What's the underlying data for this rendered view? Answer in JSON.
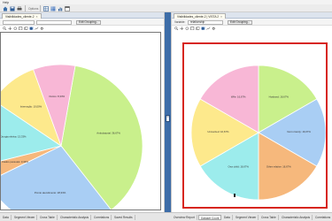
{
  "menubar": {
    "items": [
      "Help"
    ]
  },
  "toolbar": {
    "label": "Options"
  },
  "left_panel": {
    "tab_label": "Visibilidades_cliente-2",
    "tab_close": "×",
    "edit_grouping": "Edit Grouping...",
    "slices": [
      {
        "label": "Ambulatorial: 36,67%",
        "percent": 36.67,
        "color": "#c9f08c"
      },
      {
        "label": "Pronto atendimento: 28,33%",
        "percent": 28.33,
        "color": "#a9cef4"
      },
      {
        "label": "Dados pessoais: 3,33%",
        "percent": 3.33,
        "color": "#f6b87c"
      },
      {
        "label": "Cirurgia eletiva: 13,33%",
        "percent": 13.33,
        "color": "#9cecec"
      },
      {
        "label": "Internação: 10,00%",
        "percent": 10.0,
        "color": "#fde98c"
      },
      {
        "label": "Outros: 8,33%",
        "percent": 8.33,
        "color": "#f8b7d6"
      }
    ]
  },
  "right_panel": {
    "tab_label": "Visibilidades_cliente-2 | VISTA 2",
    "tab_close": "×",
    "variable_label": "Variable:",
    "variable_value": "relationship",
    "edit_grouping": "Edit Grouping...",
    "slices": [
      {
        "label": "Husband: 16,67%",
        "percent": 16.67,
        "color": "#c9f08c"
      },
      {
        "label": "Not in family: 16,67%",
        "percent": 16.67,
        "color": "#a9cef4"
      },
      {
        "label": "Other relative: 16,67%",
        "percent": 16.67,
        "color": "#f6b87c"
      },
      {
        "label": "Own child: 16,67%",
        "percent": 16.67,
        "color": "#9cecec"
      },
      {
        "label": "Unmarried: 16,67%",
        "percent": 16.67,
        "color": "#fde98c"
      },
      {
        "label": "Wife: 16,67%",
        "percent": 16.67,
        "color": "#f8b7d6"
      }
    ]
  },
  "bottom_tabs_left": [
    "Data",
    "Segment Viewer",
    "Cross Table",
    "Characteristic Analysis",
    "Correlations",
    "Saved Results"
  ],
  "bottom_tabs_right": [
    "Overview Report",
    "Dataset Count",
    "Data",
    "Segment Viewer",
    "Cross Table",
    "Characteristic Analysis",
    "Correlations",
    "Saved Results"
  ],
  "bottom_active_right": "Dataset Count",
  "colors": {
    "accent": "#3d6da8",
    "selection": "#d7261e"
  }
}
